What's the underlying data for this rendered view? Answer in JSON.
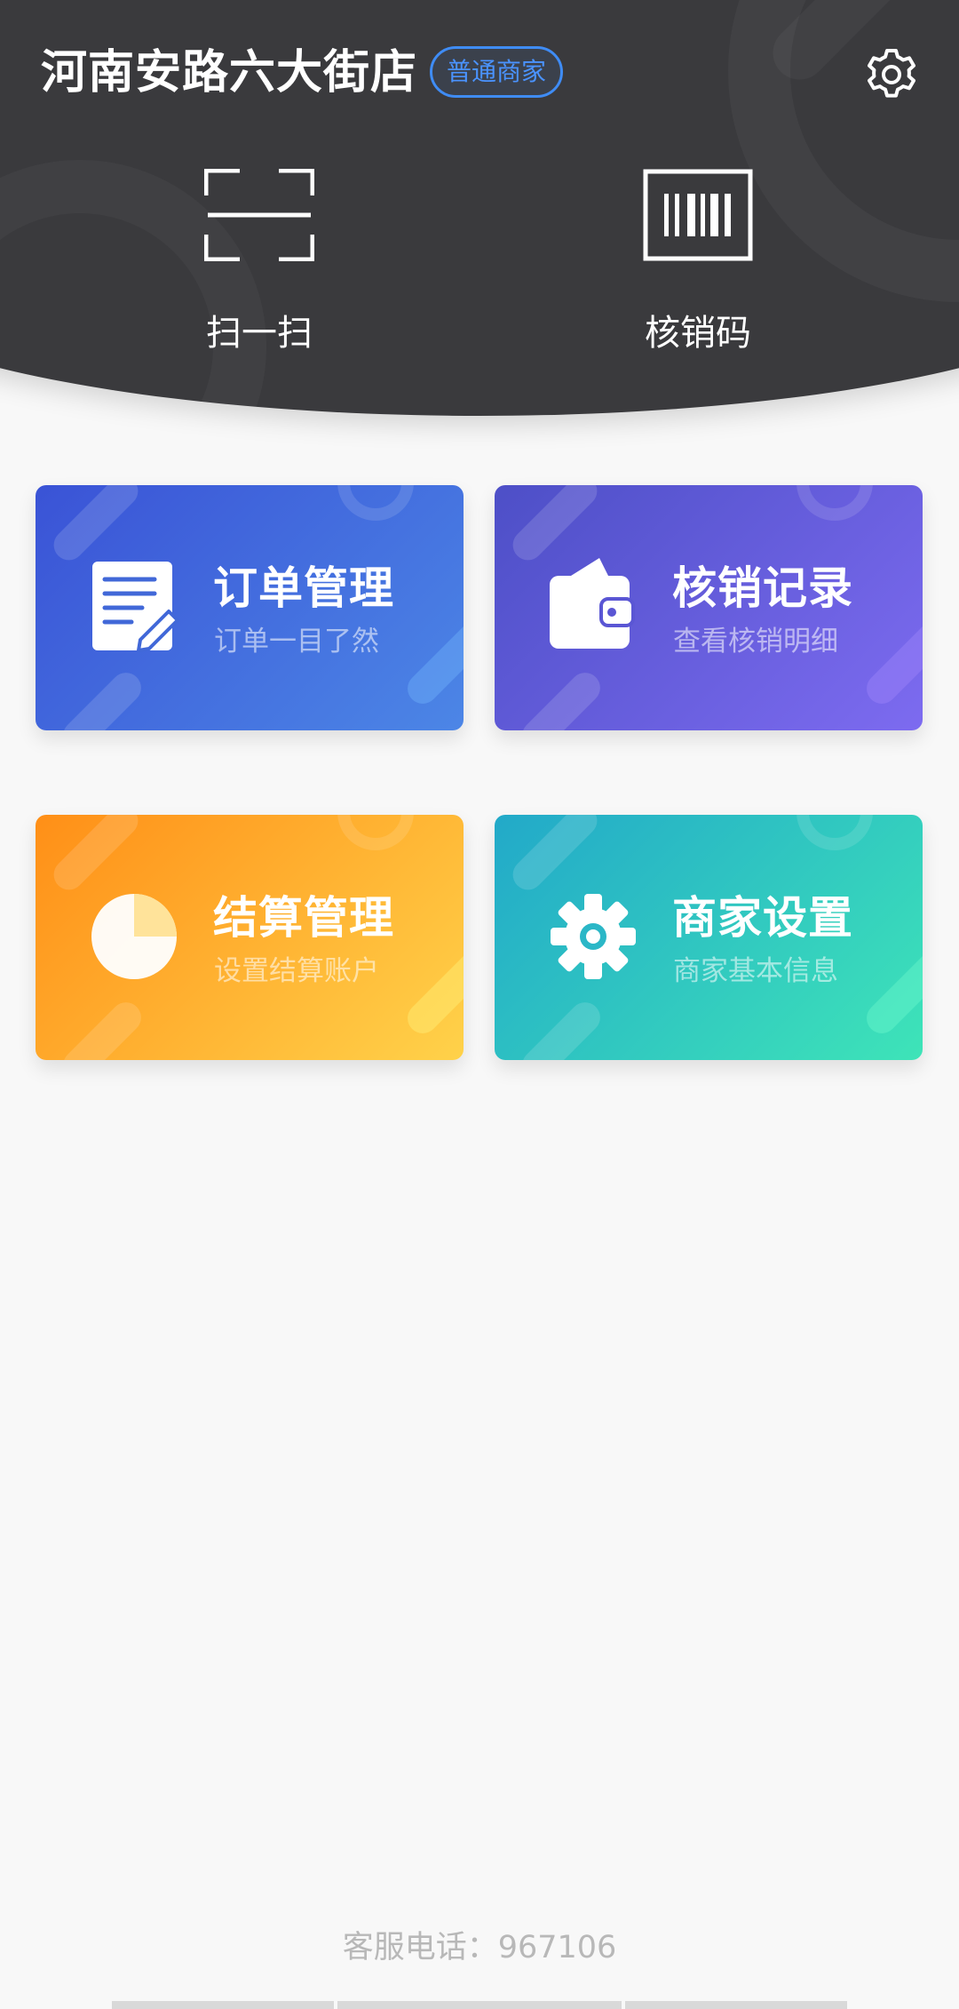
{
  "header": {
    "store_name": "河南安路六大街店",
    "badge": "普通商家",
    "quick_actions": [
      {
        "label": "扫一扫",
        "icon": "scan-icon"
      },
      {
        "label": "核销码",
        "icon": "barcode-icon"
      }
    ]
  },
  "cards": [
    {
      "title": "订单管理",
      "subtitle": "订单一目了然",
      "icon": "document-edit-icon"
    },
    {
      "title": "核销记录",
      "subtitle": "查看核销明细",
      "icon": "wallet-icon"
    },
    {
      "title": "结算管理",
      "subtitle": "设置结算账户",
      "icon": "pie-chart-icon"
    },
    {
      "title": "商家设置",
      "subtitle": "商家基本信息",
      "icon": "gear-icon"
    }
  ],
  "footer": {
    "service_phone": "客服电话：967106"
  },
  "colors": {
    "header_bg": "#3a3a3d",
    "badge_accent": "#4a93ff",
    "orders_gradient": [
      "#3a53d6",
      "#4c86e6"
    ],
    "records_gradient": [
      "#4d4fc7",
      "#7d6bf0"
    ],
    "settle_gradient": [
      "#ff8f17",
      "#ffd24a"
    ],
    "merchant_gradient": [
      "#22a9c9",
      "#3ee4b8"
    ]
  }
}
